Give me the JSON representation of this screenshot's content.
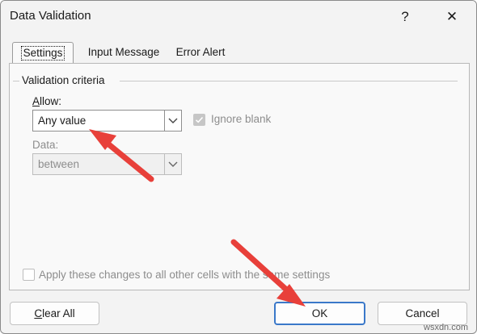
{
  "dialog": {
    "title": "Data Validation",
    "help_glyph": "?",
    "close_glyph": "✕"
  },
  "tabs": [
    {
      "label": "Settings",
      "active": true
    },
    {
      "label": "Input Message",
      "active": false
    },
    {
      "label": "Error Alert",
      "active": false
    }
  ],
  "settings": {
    "group_label": "Validation criteria",
    "allow": {
      "label_accel": "A",
      "label_rest": "llow:",
      "value": "Any value"
    },
    "ignore_blank": {
      "label": "Ignore blank",
      "checked": true,
      "enabled": false
    },
    "data": {
      "label": "Data:",
      "value": "between",
      "enabled": false
    },
    "apply_all": {
      "label": "Apply these changes to all other cells with the same settings",
      "checked": false,
      "enabled": false
    }
  },
  "buttons": {
    "clear_all": {
      "accel": "C",
      "rest": "lear All"
    },
    "ok": "OK",
    "cancel": "Cancel"
  },
  "annotation_color": "#e8403a",
  "watermark": "wsxdn.com"
}
